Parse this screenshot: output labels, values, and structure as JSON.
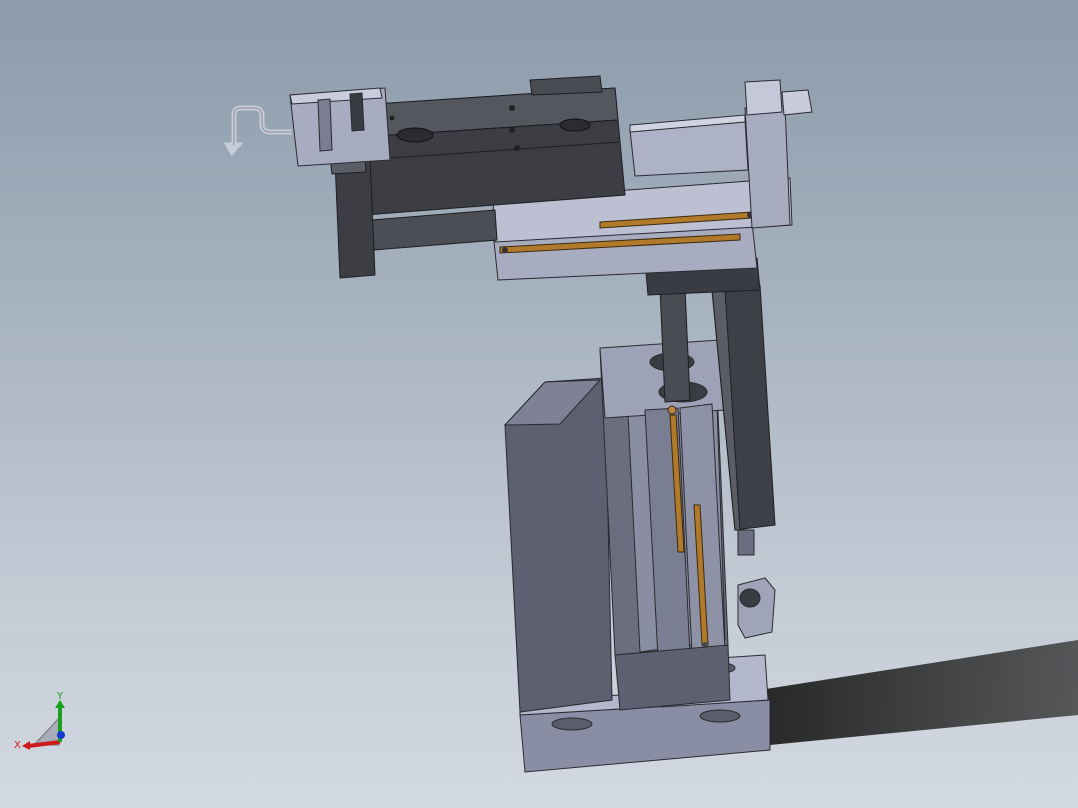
{
  "viewport": {
    "background_top": "#8c9aaa",
    "background_bottom": "#d3d9e1"
  },
  "triad": {
    "x_label": "X",
    "y_label": "Y",
    "x_color": "#cc1a1a",
    "y_color": "#1aa01a",
    "z_color": "#1a3acc"
  },
  "colors": {
    "metal_dark": "#3c3e44",
    "metal_mid": "#6a6e7a",
    "metal_light": "#a8acc0",
    "metal_face": "#8a8ea4",
    "brass": "#b07a2a",
    "shadow": "#2a2a2a"
  }
}
